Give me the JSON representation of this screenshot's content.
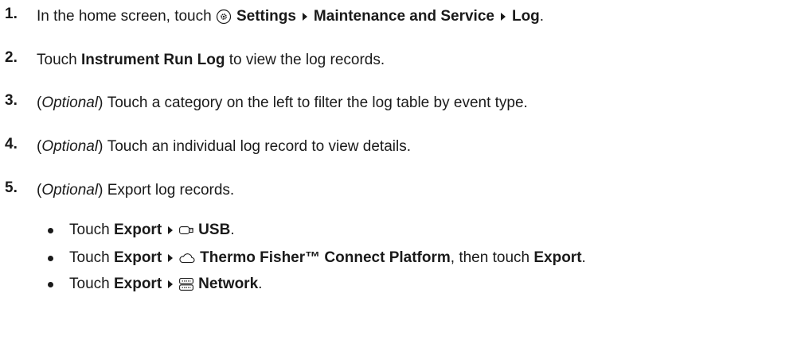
{
  "steps": [
    {
      "number": "1.",
      "prefix": "In the home screen, touch",
      "icon": "settings-gear-icon",
      "path": [
        "Settings",
        "Maintenance and Service",
        "Log"
      ],
      "suffix": "."
    },
    {
      "number": "2.",
      "prefix": "Touch",
      "bold": "Instrument Run Log",
      "suffix": "to view the log records."
    },
    {
      "number": "3.",
      "optional": "Optional",
      "text": "Touch a category on the left to filter the log table by event type."
    },
    {
      "number": "4.",
      "optional": "Optional",
      "text": "Touch an individual log record to view details."
    },
    {
      "number": "5.",
      "optional": "Optional",
      "text": "Export log records."
    }
  ],
  "export_options": [
    {
      "touch": "Touch",
      "menu": "Export",
      "icon": "usb-icon",
      "target": "USB",
      "tail": "."
    },
    {
      "touch": "Touch",
      "menu": "Export",
      "icon": "cloud-icon",
      "target": "Thermo Fisher™ Connect Platform",
      "tail_pre": ", then touch",
      "tail_bold": "Export",
      "tail": "."
    },
    {
      "touch": "Touch",
      "menu": "Export",
      "icon": "network-icon",
      "target": "Network",
      "tail": "."
    }
  ]
}
